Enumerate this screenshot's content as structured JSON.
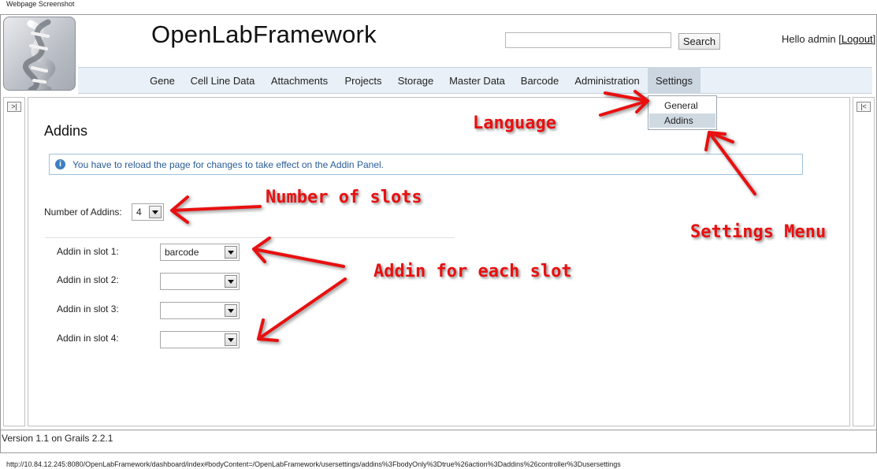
{
  "captions": {
    "top": "Webpage Screenshot",
    "url": "http://10.84.12.245:8080/OpenLabFramework/dashboard/index#bodyContent=/OpenLabFramework/usersettings/addins%3FbodyOnly%3Dtrue%26action%3Daddins%26controller%3Dusersettings"
  },
  "header": {
    "app_title": "OpenLabFramework",
    "search_button": "Search",
    "search_value": "",
    "greeting": "Hello admin",
    "logout_open": "[",
    "logout_label": "Logout",
    "logout_close": "]"
  },
  "nav": {
    "items": [
      "Gene",
      "Cell Line Data",
      "Attachments",
      "Projects",
      "Storage",
      "Master Data",
      "Barcode",
      "Administration",
      "Settings"
    ],
    "active": "Settings",
    "dropdown": [
      "General",
      "Addins"
    ],
    "dropdown_highlight": "Addins"
  },
  "sidebars": {
    "left_toggle": ">|",
    "right_toggle": "|<"
  },
  "main": {
    "title": "Addins",
    "info_icon": "i",
    "info_text": "You have to reload the page for changes to take effect on the Addin Panel.",
    "number_label": "Number of Addins:",
    "number_value": "4",
    "slots": [
      {
        "label": "Addin in slot 1:",
        "value": "barcode"
      },
      {
        "label": "Addin in slot 2:",
        "value": ""
      },
      {
        "label": "Addin in slot 3:",
        "value": ""
      },
      {
        "label": "Addin in slot 4:",
        "value": ""
      }
    ]
  },
  "footer": {
    "version": "Version 1.1 on Grails 2.2.1"
  },
  "annotations": {
    "language": "Language",
    "slots": "Number of slots",
    "settings_menu": "Settings Menu",
    "addin_each": "Addin for each slot",
    "color": "#e81010"
  }
}
